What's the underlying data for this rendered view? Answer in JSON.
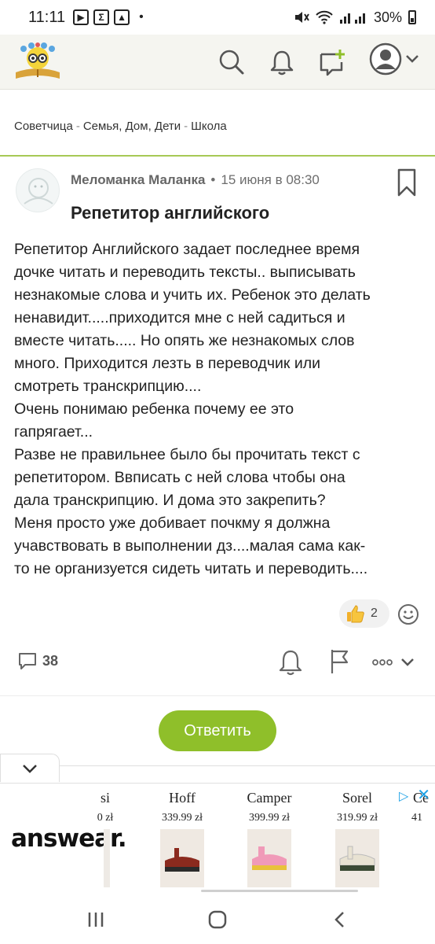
{
  "status_bar": {
    "time": "11:11",
    "battery": "30%",
    "icons": [
      "youtube-icon",
      "sigma-icon",
      "gallery-icon",
      "mute-icon",
      "wifi-icon",
      "signal-icon",
      "battery-icon"
    ]
  },
  "header": {
    "logo": "sovetchitsa-logo",
    "actions": [
      "search-icon",
      "bell-icon",
      "new-post-icon",
      "user-avatar-icon"
    ]
  },
  "breadcrumb": {
    "items": [
      "Советчица",
      "Семья, Дом, Дети",
      "Школа"
    ],
    "separator": "-"
  },
  "post": {
    "author": "Меломанка Маланка",
    "meta_dot": "•",
    "date": "15 июня в 08:30",
    "title": "Репетитор английского",
    "body_lines": [
      "Репетитор Английского задает последнее время",
      "дочке читать и переводить тексты.. выписывать",
      "незнакомые слова и учить их. Ребенок это делать",
      "ненавидит.....приходится мне с ней садиться и",
      "вместе читать..... Но опять же незнакомых слов",
      "много. Приходится лезть в переводчик или",
      "смотреть транскрипцию....",
      "Очень понимаю ребенка почему ее это",
      "гапрягает...",
      "Разве не правильнее было бы прочитать текст с",
      "репетитором. Ввписать с ней слова чтобы она",
      "дала транскрипцию. И дома это закрепить?",
      "Меня просто уже добивает почкму я должна",
      "учавствовать в выполнении дз....малая сама как-",
      "то не организуется сидеть читать и переводить...."
    ],
    "reactions": {
      "thumbs_up_count": "2"
    },
    "comments_count": "38"
  },
  "reply_button": "Ответить",
  "ad": {
    "logo_text": "answear.",
    "items": [
      {
        "brand": "si",
        "price": "0 zł"
      },
      {
        "brand": "Hoff",
        "price": "339.99 zł"
      },
      {
        "brand": "Camper",
        "price": "399.99 zł"
      },
      {
        "brand": "Sorel",
        "price": "319.99 zł"
      },
      {
        "brand": "Ce",
        "price": "41"
      }
    ]
  },
  "colors": {
    "accent_green": "#8fbf2a",
    "divider_green": "#a6c955",
    "ad_blue": "#1ea2e6"
  }
}
